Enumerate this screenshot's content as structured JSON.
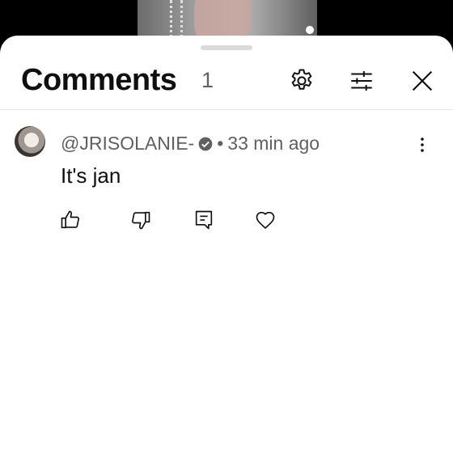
{
  "sheet": {
    "title": "Comments",
    "count": "1"
  },
  "header_icons": [
    "gear-icon",
    "filter-sliders-icon",
    "close-icon"
  ],
  "comments": [
    {
      "handle": "@JRISOLANIE-",
      "verified": true,
      "separator": "•",
      "time": "33 min ago",
      "text": "It's jan"
    }
  ],
  "comment_actions": [
    "thumb-up-icon",
    "thumb-down-icon",
    "reply-icon",
    "heart-icon"
  ],
  "colors": {
    "background_top": "#000000",
    "sheet": "#ffffff",
    "primary_text": "#0f0f0f",
    "secondary_text": "#606060",
    "divider": "#e5e5e5"
  }
}
